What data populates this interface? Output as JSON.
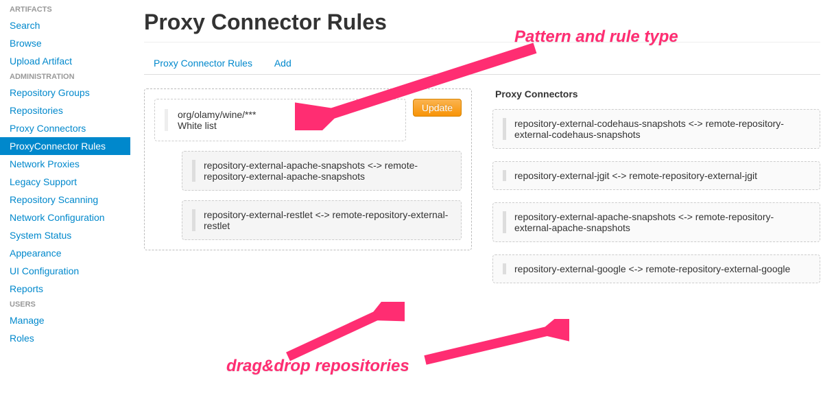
{
  "sidebar": {
    "sections": [
      {
        "header": "ARTIFACTS",
        "items": [
          "Search",
          "Browse",
          "Upload Artifact"
        ]
      },
      {
        "header": "ADMINISTRATION",
        "items": [
          "Repository Groups",
          "Repositories",
          "Proxy Connectors",
          "ProxyConnector Rules",
          "Network Proxies",
          "Legacy Support",
          "Repository Scanning",
          "Network Configuration",
          "System Status",
          "Appearance",
          "UI Configuration",
          "Reports"
        ]
      },
      {
        "header": "USERS",
        "items": [
          "Manage",
          "Roles"
        ]
      }
    ],
    "active": "ProxyConnector Rules"
  },
  "page": {
    "title": "Proxy Connector Rules",
    "tabs": [
      "Proxy Connector Rules",
      "Add"
    ]
  },
  "rule": {
    "pattern": "org/olamy/wine/***",
    "type": "White list",
    "update_label": "Update",
    "assigned": [
      "repository-external-apache-snapshots <-> remote-repository-external-apache-snapshots",
      "repository-external-restlet <-> remote-repository-external-restlet"
    ]
  },
  "connectors": {
    "heading": "Proxy Connectors",
    "items": [
      "repository-external-codehaus-snapshots <-> remote-repository-external-codehaus-snapshots",
      "repository-external-jgit <-> remote-repository-external-jgit",
      "repository-external-apache-snapshots <-> remote-repository-external-apache-snapshots",
      "repository-external-google <-> remote-repository-external-google"
    ]
  },
  "annotations": {
    "top": "Pattern and rule type",
    "bottom": "drag&drop repositories"
  }
}
